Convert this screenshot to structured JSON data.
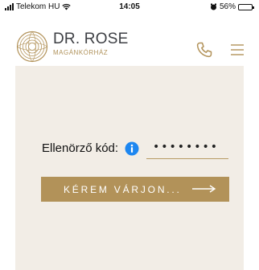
{
  "status_bar": {
    "carrier": "Telekom HU",
    "time": "14:05",
    "battery_percent": "56%",
    "battery_level": 0.56,
    "icons": [
      "signal-icon",
      "wifi-icon",
      "alarm-icon",
      "battery-icon"
    ]
  },
  "header": {
    "brand_name": "DR. ROSE",
    "brand_subtitle": "MAGÁNKÓRHÁZ",
    "icons": [
      "logo-icon",
      "phone-icon",
      "menu-icon"
    ]
  },
  "form": {
    "code_label": "Ellenörző kód:",
    "code_value": "••••••••",
    "info_icon": "info-icon",
    "submit_label": "KÉREM VÁRJON...",
    "submit_icon": "arrow-right-icon"
  },
  "colors": {
    "accent_gold": "#b29259",
    "card_background": "#f2ede6",
    "info_blue": "#1e87f0",
    "text_dark": "#3d3f44"
  }
}
